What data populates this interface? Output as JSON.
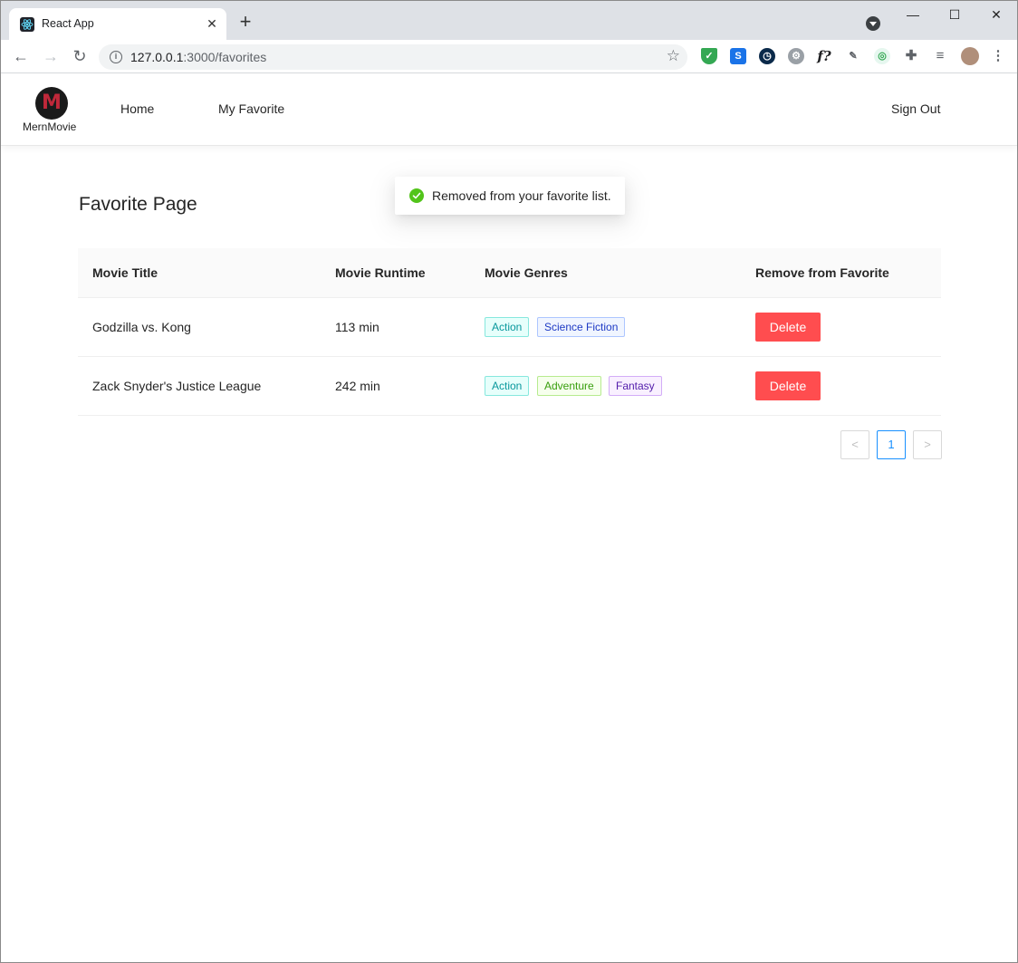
{
  "browser": {
    "tab_title": "React App",
    "url_host": "127.0.0.1",
    "url_path": ":3000/favorites"
  },
  "app": {
    "logo_text": "MernMovie",
    "logo_letter": "M",
    "nav": {
      "home": "Home",
      "favorite": "My Favorite",
      "signout": "Sign Out"
    }
  },
  "page": {
    "title": "Favorite Page"
  },
  "toast": {
    "message": "Removed from your favorite list."
  },
  "table": {
    "headers": [
      "Movie Title",
      "Movie Runtime",
      "Movie Genres",
      "Remove from Favorite"
    ],
    "rows": [
      {
        "title": "Godzilla vs. Kong",
        "runtime": "113 min",
        "genres": [
          "Action",
          "Science Fiction"
        ],
        "action": "Delete"
      },
      {
        "title": "Zack Snyder's Justice League",
        "runtime": "242 min",
        "genres": [
          "Action",
          "Adventure",
          "Fantasy"
        ],
        "action": "Delete"
      }
    ]
  },
  "pagination": {
    "prev": "<",
    "current": "1",
    "next": ">"
  },
  "colors": {
    "delete": "#ff4d4f",
    "active_page": "#1890ff",
    "success": "#52c41a"
  }
}
